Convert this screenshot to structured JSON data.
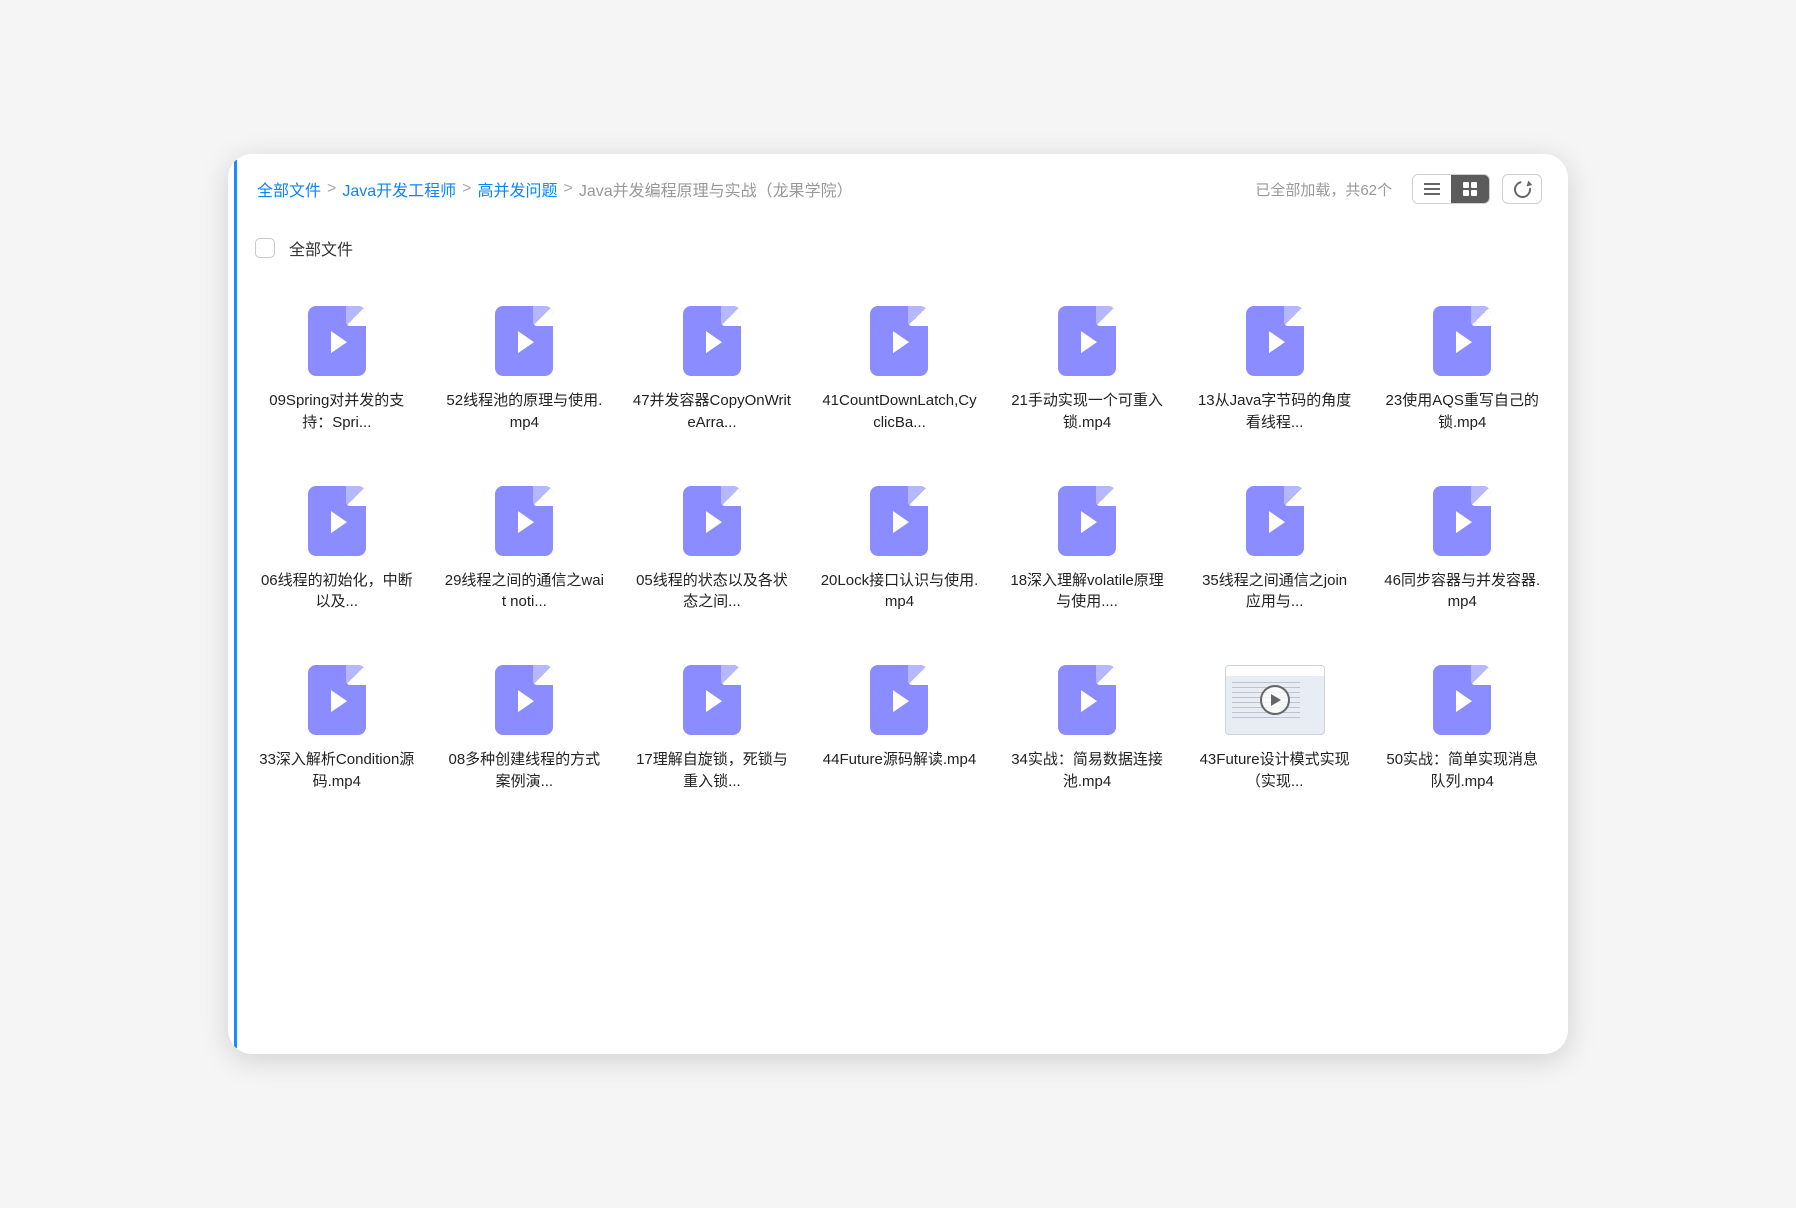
{
  "breadcrumb": {
    "items": [
      {
        "label": "全部文件",
        "link": true
      },
      {
        "label": "Java开发工程师",
        "link": true
      },
      {
        "label": "高并发问题",
        "link": true
      },
      {
        "label": "Java并发编程原理与实战（龙果学院）",
        "link": false
      }
    ]
  },
  "status_text": "已全部加载，共62个",
  "select_all_label": "全部文件",
  "files": [
    {
      "name": "09Spring对并发的支持：Spri...",
      "thumb": false
    },
    {
      "name": "52线程池的原理与使用.mp4",
      "thumb": false
    },
    {
      "name": "47并发容器CopyOnWriteArra...",
      "thumb": false
    },
    {
      "name": "41CountDownLatch,CyclicBa...",
      "thumb": false
    },
    {
      "name": "21手动实现一个可重入锁.mp4",
      "thumb": false
    },
    {
      "name": "13从Java字节码的角度看线程...",
      "thumb": false
    },
    {
      "name": "23使用AQS重写自己的锁.mp4",
      "thumb": false
    },
    {
      "name": "06线程的初始化，中断以及...",
      "thumb": false
    },
    {
      "name": "29线程之间的通信之wait noti...",
      "thumb": false
    },
    {
      "name": "05线程的状态以及各状态之间...",
      "thumb": false
    },
    {
      "name": "20Lock接口认识与使用.mp4",
      "thumb": false
    },
    {
      "name": "18深入理解volatile原理与使用....",
      "thumb": false
    },
    {
      "name": "35线程之间通信之join应用与...",
      "thumb": false
    },
    {
      "name": "46同步容器与并发容器.mp4",
      "thumb": false
    },
    {
      "name": "33深入解析Condition源码.mp4",
      "thumb": false
    },
    {
      "name": "08多种创建线程的方式案例演...",
      "thumb": false
    },
    {
      "name": "17理解自旋锁，死锁与重入锁...",
      "thumb": false
    },
    {
      "name": "44Future源码解读.mp4",
      "thumb": false
    },
    {
      "name": "34实战：简易数据连接池.mp4",
      "thumb": false
    },
    {
      "name": "43Future设计模式实现（实现...",
      "thumb": true
    },
    {
      "name": "50实战：简单实现消息队列.mp4",
      "thumb": false
    }
  ]
}
